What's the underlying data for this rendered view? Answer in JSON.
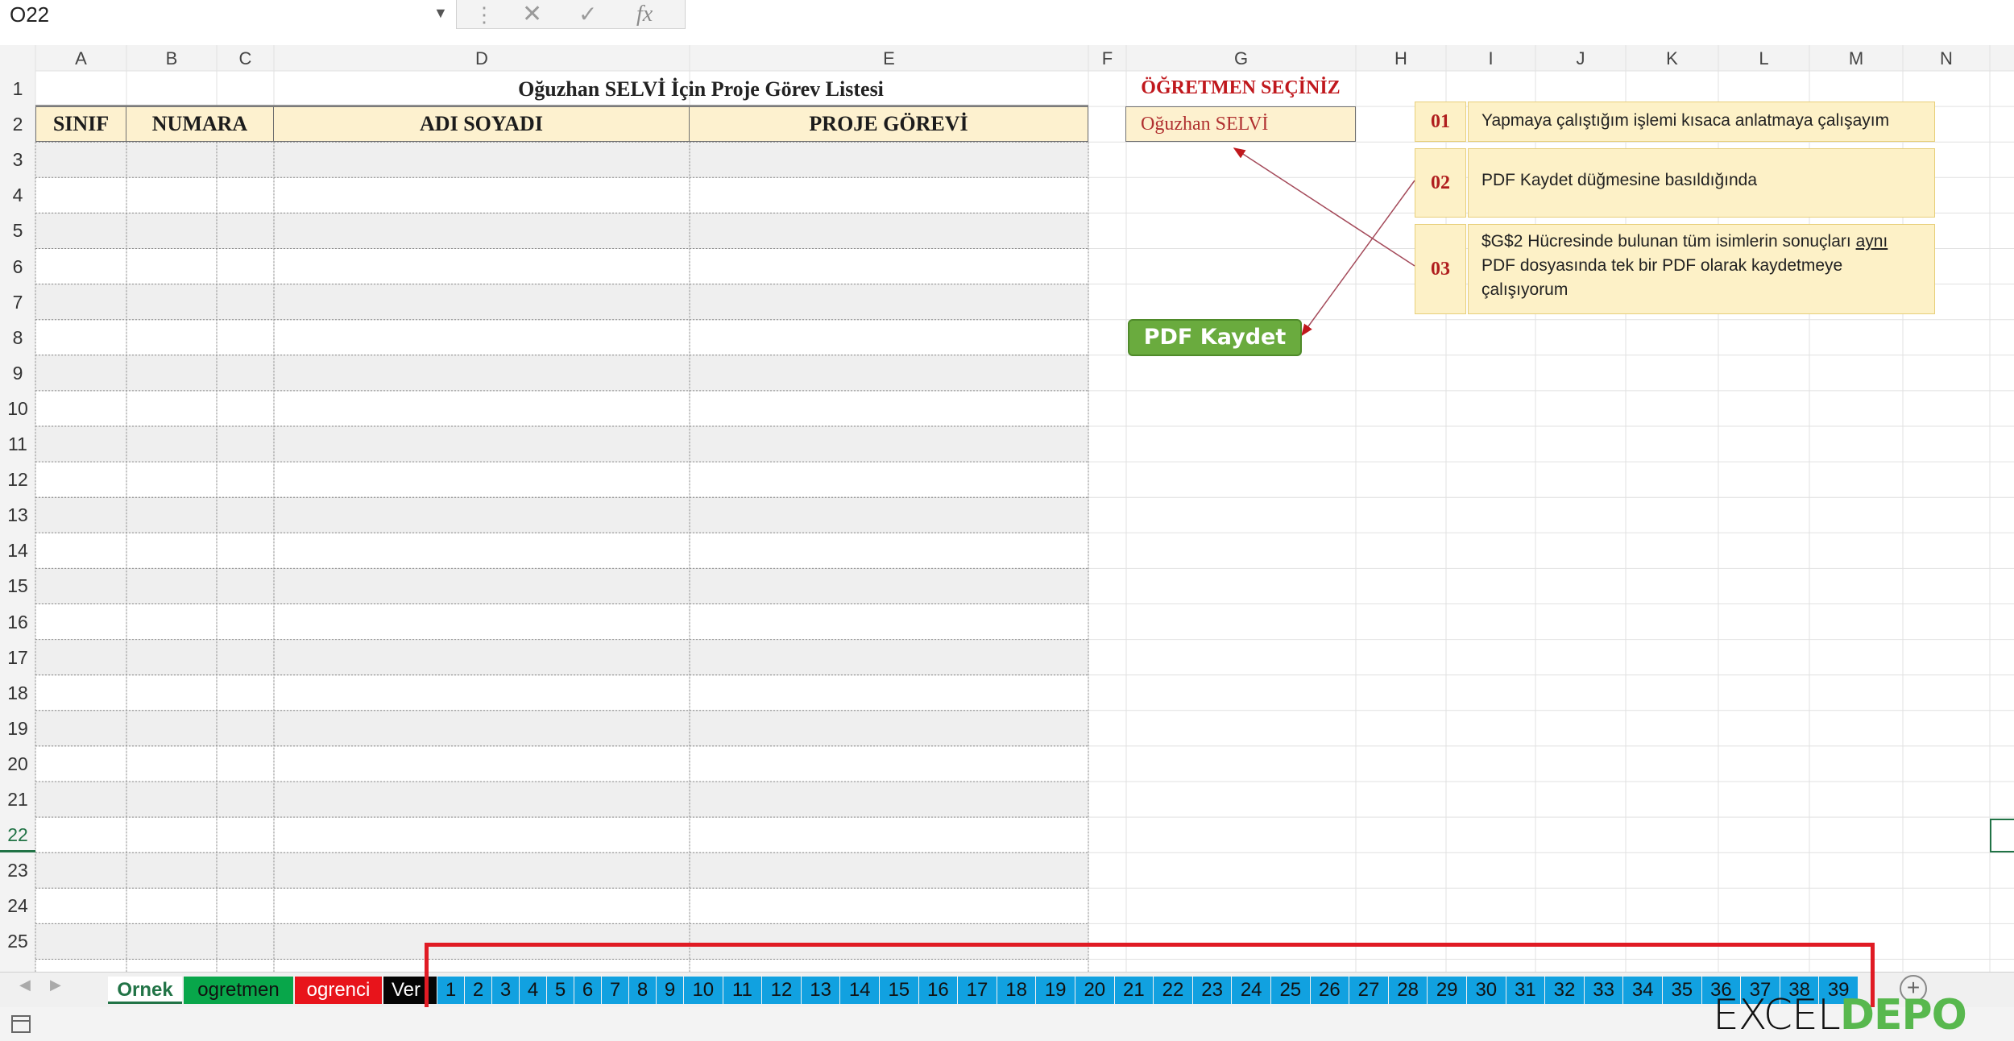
{
  "formula_bar": {
    "name_box": "O22",
    "name_box_caret": "▼",
    "dots": "⋮",
    "cancel_icon": "✕",
    "enter_icon": "✓",
    "fx_label": "fx",
    "formula": ""
  },
  "columns": [
    "A",
    "B",
    "C",
    "D",
    "E",
    "F",
    "G",
    "H",
    "I",
    "J",
    "K",
    "L",
    "M",
    "N"
  ],
  "rows": [
    "1",
    "2",
    "3",
    "4",
    "5",
    "6",
    "7",
    "8",
    "9",
    "10",
    "11",
    "12",
    "13",
    "14",
    "15",
    "16",
    "17",
    "18",
    "19",
    "20",
    "21",
    "22",
    "23",
    "24",
    "25"
  ],
  "sheet": {
    "title": "Oğuzhan SELVİ İçin Proje Görev Listesi",
    "headers": {
      "sinif": "SINIF",
      "numara": "NUMARA",
      "adi_soyadi": "ADI SOYADI",
      "proje_gorevi": "PROJE GÖREVİ"
    },
    "teacher_label": "ÖĞRETMEN SEÇİNİZ",
    "teacher_value": "Oğuzhan SELVİ",
    "notes": [
      {
        "num": "01",
        "text": "Yapmaya çalıştığım işlemi kısaca anlatmaya çalışayım"
      },
      {
        "num": "02",
        "text": "PDF Kaydet düğmesine basıldığında"
      },
      {
        "num": "03",
        "text_before": "$G$2 Hücresinde bulunan tüm isimlerin sonuçları ",
        "text_underlined": "aynı",
        "text_after": " PDF dosyasında tek bir PDF olarak kaydetmeye çalışıyorum"
      }
    ],
    "pdf_button": "PDF Kaydet"
  },
  "tabs": {
    "nav_prev": "◀",
    "nav_next": "▶",
    "named": [
      {
        "label": "Ornek",
        "color": "#ffffff"
      },
      {
        "label": "ogretmen",
        "color": "#08a64a"
      },
      {
        "label": "ogrenci",
        "color": "#e8141b"
      },
      {
        "label": "Ver",
        "color": "#050505"
      }
    ],
    "numbered": [
      "1",
      "2",
      "3",
      "4",
      "5",
      "6",
      "7",
      "8",
      "9",
      "10",
      "11",
      "12",
      "13",
      "14",
      "15",
      "16",
      "17",
      "18",
      "19",
      "20",
      "21",
      "22",
      "23",
      "24",
      "25",
      "26",
      "27",
      "28",
      "29",
      "30",
      "31",
      "32",
      "33",
      "34",
      "35",
      "36",
      "37",
      "38",
      "39"
    ],
    "numbered_color": "#11a1e0",
    "add_sheet": "+",
    "highlight_color": "#e01b24"
  },
  "logo": {
    "part1": "EXCEL",
    "part2": "DEPO"
  },
  "colors": {
    "accent_green": "#217346",
    "header_fill": "#fdf1cf",
    "note_fill": "#fdf1c7",
    "label_red": "#c0181d",
    "button_green": "#6aab3e"
  }
}
